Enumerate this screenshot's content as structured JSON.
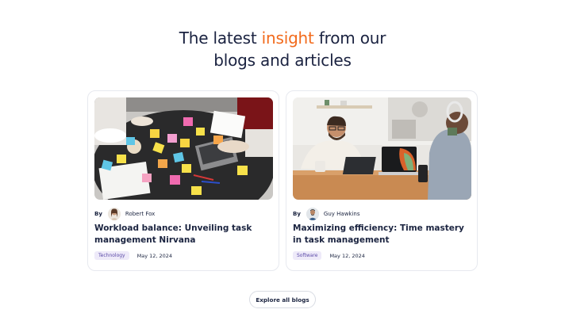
{
  "heading": {
    "line1_prefix": "The latest ",
    "line1_accent": "insight",
    "line1_suffix": " from our",
    "line2": "blogs and articles"
  },
  "colors": {
    "accent": "#f26b1d",
    "tag_bg": "#eeeaf9",
    "tag_text": "#5b4aa8"
  },
  "posts": [
    {
      "by_label": "By",
      "author": "Robert Fox",
      "title": "Workload balance: Unveiling task management Nirvana",
      "category": "Technology",
      "date": "May 12, 2024"
    },
    {
      "by_label": "By",
      "author": "Guy Hawkins",
      "title": "Maximizing efficiency: Time mastery in task management",
      "category": "Software",
      "date": "May 12, 2024"
    }
  ],
  "explore_label": "Explore all blogs"
}
